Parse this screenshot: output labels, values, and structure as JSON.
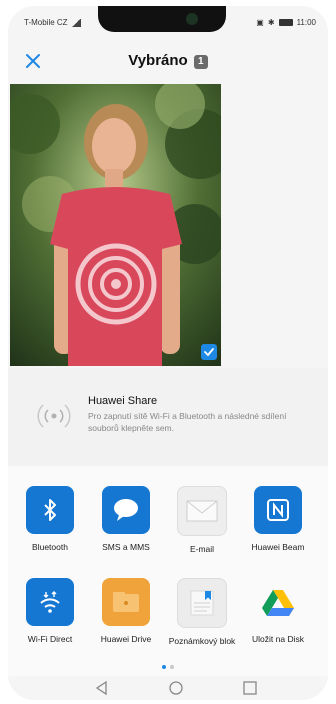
{
  "status": {
    "carrier": "T-Mobile CZ",
    "time": "11:00"
  },
  "header": {
    "title": "Vybráno",
    "count": "1"
  },
  "huawei_share": {
    "title": "Huawei Share",
    "description": "Pro zapnutí sítě Wi-Fi a Bluetooth a následné sdílení souborů klepněte sem."
  },
  "apps": [
    {
      "label": "Bluetooth",
      "icon": "bluetooth-icon",
      "color": "#1677d2"
    },
    {
      "label": "SMS a MMS",
      "icon": "message-icon",
      "color": "#1677d2"
    },
    {
      "label": "E-mail",
      "icon": "envelope-icon",
      "color": "#eeeeee"
    },
    {
      "label": "Huawei Beam",
      "icon": "nfc-icon",
      "color": "#1677d2"
    },
    {
      "label": "Wi-Fi Direct",
      "icon": "wifi-direct-icon",
      "color": "#1677d2"
    },
    {
      "label": "Huawei Drive",
      "icon": "drive-folder-icon",
      "color": "#f0a33a"
    },
    {
      "label": "Poznámkový blok",
      "icon": "notepad-icon",
      "color": "#ececec"
    },
    {
      "label": "Uložit na Disk",
      "icon": "google-drive-icon",
      "color": "#fafafa"
    }
  ],
  "pagination": {
    "current": 1,
    "total": 2
  }
}
